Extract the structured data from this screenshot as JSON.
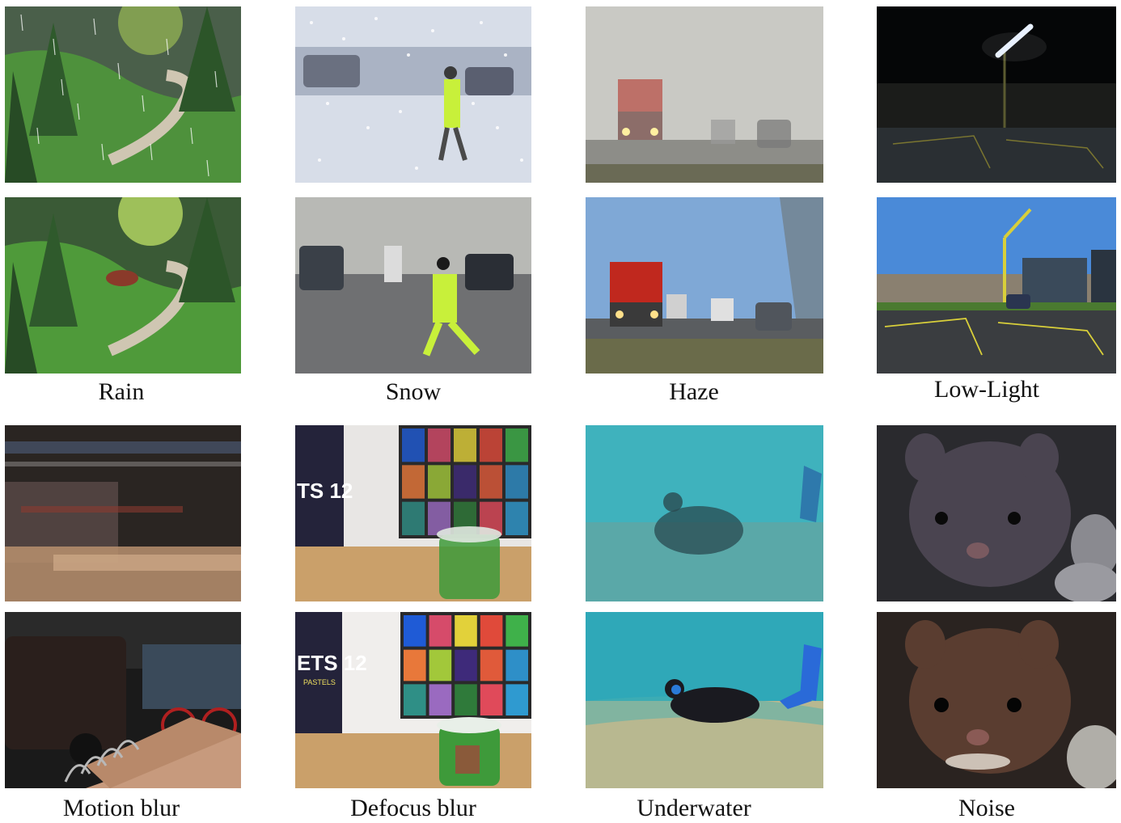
{
  "captions": {
    "rain": "Rain",
    "snow": "Snow",
    "haze": "Haze",
    "lowlight": "Low-Light",
    "motion": "Motion blur",
    "defocus": "Defocus blur",
    "underwater": "Underwater",
    "noise": "Noise"
  },
  "photo_text": {
    "box_degraded": "TS 12",
    "box_clean": "ETS 12",
    "box_clean_small": "PASTELS"
  },
  "colors": {
    "grass": "#4f9a3a",
    "tree": "#2f5a2c",
    "path": "#cfc6b2",
    "snow": "#d7dde8",
    "jacket": "#c8f03a",
    "truck": "#c0281e",
    "sky_clean": "#7fa8d6",
    "lamp": "#d8cf3a",
    "water": "#3fb2bd",
    "fur": "#5a3d30",
    "brick": "#c79a7d",
    "wood": "#caa06a",
    "glass_liquid": "#3e9a3a",
    "checker": [
      "#1f5bd6",
      "#d64b6a",
      "#e2d13a",
      "#e04a3a",
      "#3fb14a",
      "#e8783a",
      "#a2c83a",
      "#3e2a7a",
      "#e05a3a",
      "#2e8fc8",
      "#2f8f86",
      "#9a6ac0",
      "#2f7a3a",
      "#e04a5a",
      "#2f9ad0"
    ]
  }
}
